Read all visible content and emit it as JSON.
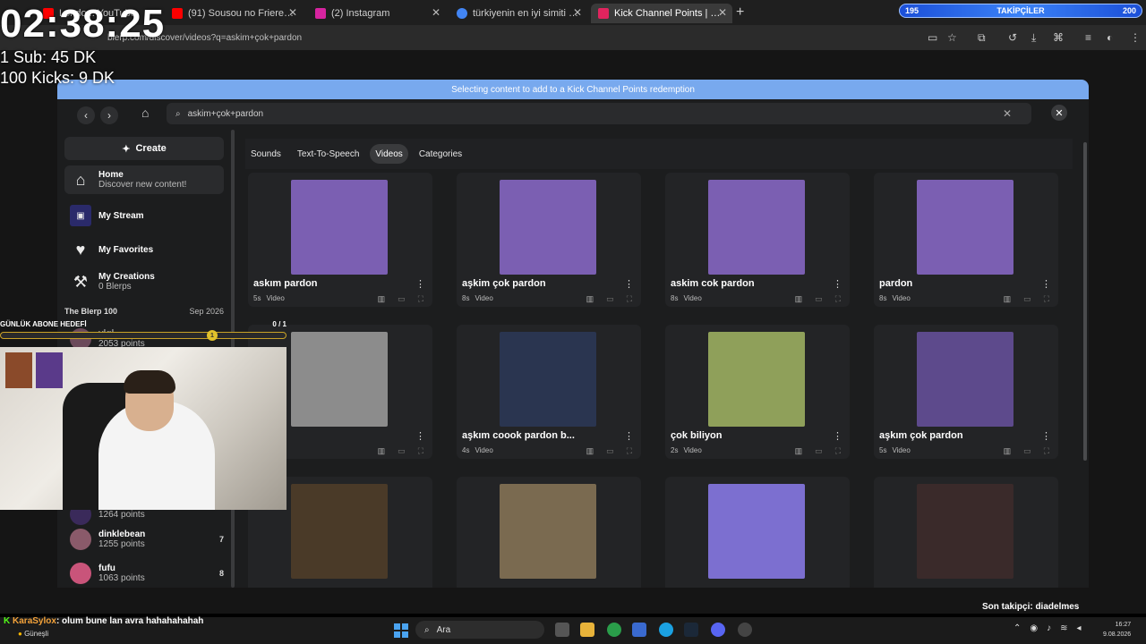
{
  "browser": {
    "tabs": [
      {
        "label": "Londo... YouTube",
        "color": "#ff0000"
      },
      {
        "label": "(91) Sousou no Frieren - Time F",
        "color": "#ff0000"
      },
      {
        "label": "(2) Instagram",
        "color": "#d6249f"
      },
      {
        "label": "türkiyenin en iyi simiti - Google",
        "color": "#4285f4"
      },
      {
        "label": "Kick Channel Points | Blerp",
        "color": "#e0245e"
      }
    ],
    "url": "blerp.com/discover/videos?q=askim+çok+pardon",
    "followers_bar": {
      "left": "195",
      "label": "TAKİPÇİLER",
      "right": "200"
    }
  },
  "modal": {
    "banner": "Selecting content to add to a Kick Channel Points redemption",
    "search_value": "askim+çok+pardon",
    "filters": [
      "Sounds",
      "Text-To-Speech",
      "Videos",
      "Categories"
    ],
    "active_filter": "Videos"
  },
  "sidebar": {
    "create": "Create",
    "items": [
      {
        "title": "Home",
        "subtitle": "Discover new content!"
      },
      {
        "title": "My Stream",
        "subtitle": ""
      },
      {
        "title": "My Favorites",
        "subtitle": ""
      },
      {
        "title": "My Creations",
        "subtitle": "0 Blerps"
      }
    ],
    "leaderboard_title": "The Blerp 100",
    "leaderboard_date": "Sep 2026",
    "leaderboard": [
      {
        "name": "vigi",
        "points": "2053 points",
        "rank": ""
      },
      {
        "name": "",
        "points": "1264 points",
        "rank": ""
      },
      {
        "name": "dinklebean",
        "points": "1255 points",
        "rank": "7"
      },
      {
        "name": "fufu",
        "points": "1063 points",
        "rank": "8"
      }
    ]
  },
  "cards": [
    {
      "title": "askım pardon",
      "duration": "5s",
      "type": "Video",
      "thumb": "#7b5fb2"
    },
    {
      "title": "aşkim çok pardon",
      "duration": "8s",
      "type": "Video",
      "thumb": "#7b5fb2"
    },
    {
      "title": "askim cok pardon",
      "duration": "8s",
      "type": "Video",
      "thumb": "#7b5fb2"
    },
    {
      "title": "pardon",
      "duration": "8s",
      "type": "Video",
      "thumb": "#7b5fb2"
    },
    {
      "title": "",
      "duration": "",
      "type": "Video",
      "thumb": "#8c8c8c"
    },
    {
      "title": "aşkım coook pardon b...",
      "duration": "4s",
      "type": "Video",
      "thumb": "#2a3550"
    },
    {
      "title": "çok biliyon",
      "duration": "2s",
      "type": "Video",
      "thumb": "#8fa05a"
    },
    {
      "title": "aşkım çok pardon",
      "duration": "5s",
      "type": "Video",
      "thumb": "#5d4a8c"
    },
    {
      "title": "",
      "duration": "",
      "type": "",
      "thumb": "#4a3a28"
    },
    {
      "title": "",
      "duration": "",
      "type": "",
      "thumb": "#7a6a50"
    },
    {
      "title": "",
      "duration": "",
      "type": "",
      "thumb": "#7c6fd0"
    },
    {
      "title": "",
      "duration": "",
      "type": "",
      "thumb": "#3a2a2a"
    }
  ],
  "overlay": {
    "timer": "02:38:25",
    "sub_line": "1 Sub: 45 DK",
    "kick_line": "100 Kicks: 9 DK",
    "goal_label": "GÜNLÜK ABONE HEDEFİ",
    "goal_count": "0 / 1",
    "goal_badge": "1",
    "chat_user": "KaraSylox",
    "chat_message": ": olum bune lan avra hahahahahah",
    "last_follower": "Son takipçi: diadelmes"
  },
  "taskbar": {
    "weather": "Güneşli",
    "search": "Ara",
    "time": "16:27",
    "date": "9.08.2026"
  }
}
